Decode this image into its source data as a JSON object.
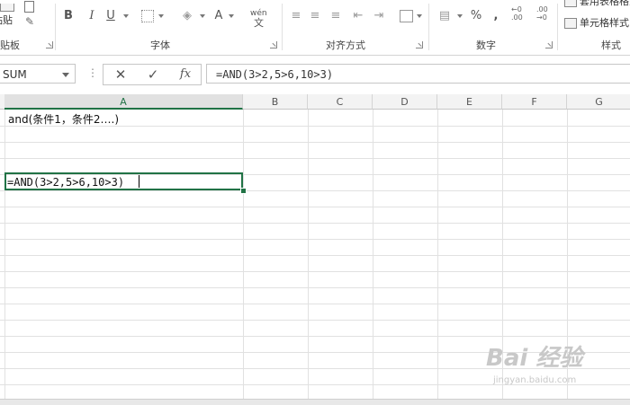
{
  "ribbon": {
    "groups": {
      "clipboard": "剪贴板",
      "font": "字体",
      "alignment": "对齐方式",
      "number": "数字",
      "styles": "样式"
    },
    "paste_label": "粘贴",
    "bold": "B",
    "italic": "I",
    "underline": "U",
    "font_color": "A",
    "phonetic": "wén",
    "percent": "%",
    "comma": ",",
    "table_format": "套用表格格式",
    "cell_style": "单元格样式"
  },
  "formula_bar": {
    "name_box": "SUM",
    "cancel": "✕",
    "enter": "✓",
    "fx": "fx",
    "formula": "=AND(3>2,5>6,10>3)"
  },
  "sheet": {
    "columns": [
      "A",
      "B",
      "C",
      "D",
      "E",
      "F",
      "G"
    ],
    "active_column": "A",
    "cells": {
      "A1": "and(条件1，条件2….)",
      "A5": "=AND(3>2,5>6,10>3)"
    }
  },
  "watermark": {
    "text": "Bai 经验",
    "sub": "jingyan.baidu.com"
  },
  "colors": {
    "accent": "#217346",
    "grid": "#e1e1e1"
  }
}
